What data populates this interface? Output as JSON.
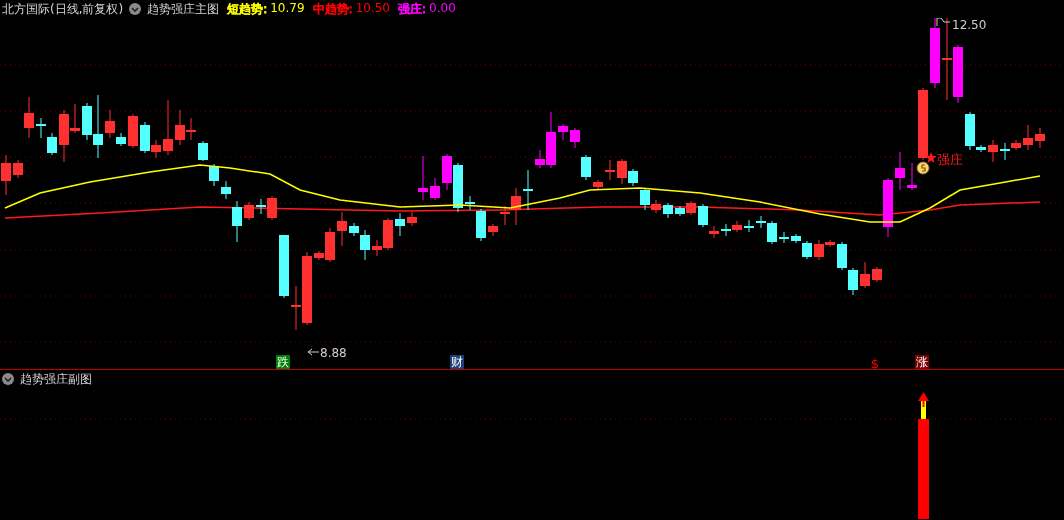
{
  "main_panel": {
    "title": "北方国际(日线,前复权)",
    "indicator": "趋势强庄主图",
    "legend": [
      {
        "label": "短趋势:",
        "value": "10.79",
        "color": "#ffff00"
      },
      {
        "label": "中趋势:",
        "value": "10.50",
        "color": "#ff0000"
      },
      {
        "label": "强庄:",
        "value": "0.00",
        "color": "#ff00ff"
      }
    ],
    "high_label": "12.50",
    "low_label": "8.88",
    "signal_label": "强庄",
    "markers": [
      {
        "kind": "badge",
        "text": "跌",
        "color": "#008000"
      },
      {
        "kind": "badge",
        "text": "财",
        "color": "#1c3f78"
      },
      {
        "kind": "glyph",
        "text": "$",
        "color": "#ff0000"
      },
      {
        "kind": "badge",
        "text": "涨",
        "color": "#7a0000"
      }
    ]
  },
  "sub_panel": {
    "indicator": "趋势强庄副图"
  }
}
